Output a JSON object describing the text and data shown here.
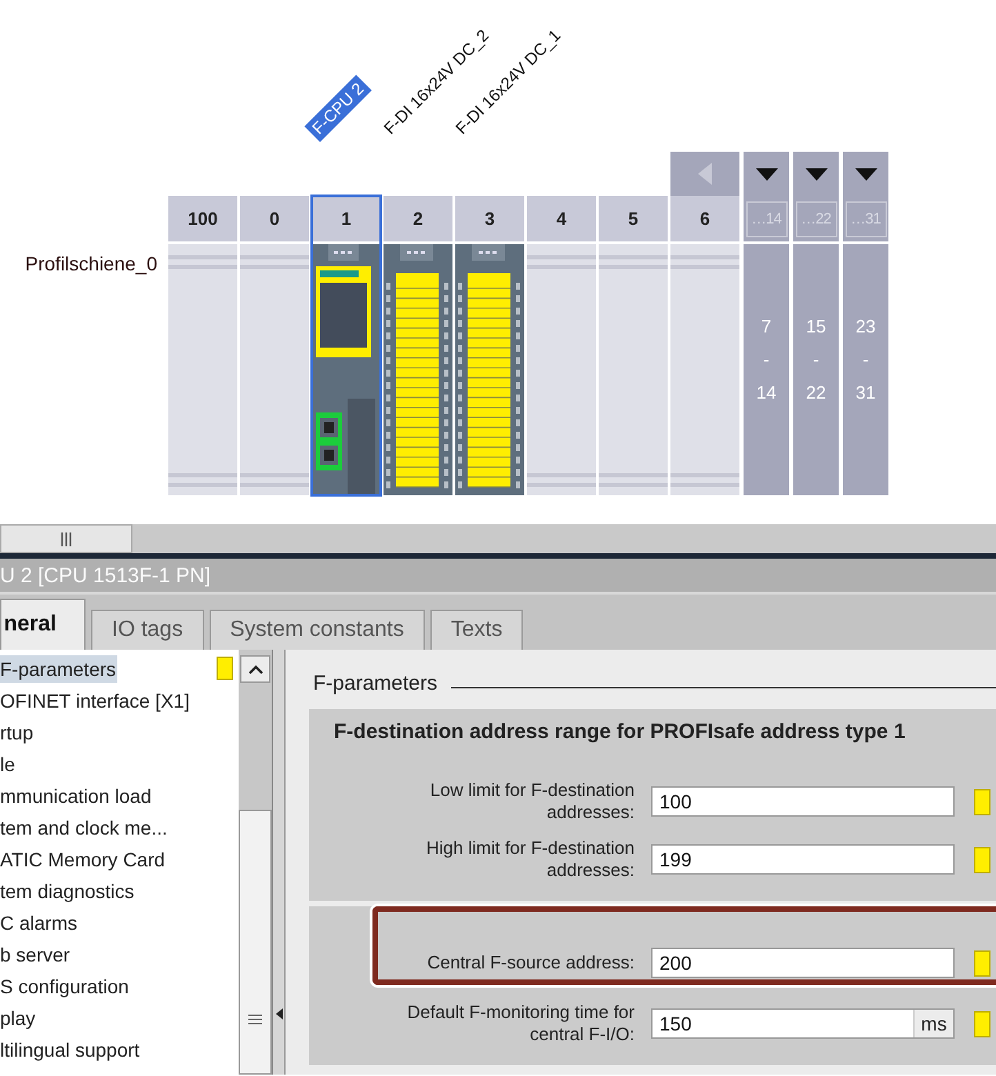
{
  "rack": {
    "rail_label": "Profilschiene_0",
    "slots": [
      {
        "number": "100",
        "kind": "empty",
        "selected": false
      },
      {
        "number": "0",
        "kind": "empty",
        "selected": false
      },
      {
        "number": "1",
        "kind": "cpu",
        "selected": true,
        "module_label": "F-CPU 2"
      },
      {
        "number": "2",
        "kind": "io",
        "selected": false,
        "module_label": "F-DI 16x24V DC_2"
      },
      {
        "number": "3",
        "kind": "io",
        "selected": false,
        "module_label": "F-DI 16x24V DC_1"
      },
      {
        "number": "4",
        "kind": "empty",
        "selected": false
      },
      {
        "number": "5",
        "kind": "empty",
        "selected": false
      },
      {
        "number": "6",
        "kind": "empty",
        "selected": false
      }
    ],
    "groups": [
      {
        "number": "…14",
        "range_start": "7",
        "range_sep": "-",
        "range_end": "14"
      },
      {
        "number": "…22",
        "range_start": "15",
        "range_sep": "-",
        "range_end": "22"
      },
      {
        "number": "…31",
        "range_start": "23",
        "range_sep": "-",
        "range_end": "31"
      }
    ]
  },
  "properties": {
    "title": "U 2 [CPU 1513F-1 PN]",
    "tabs": [
      {
        "label": "neral",
        "selected": true
      },
      {
        "label": "IO tags",
        "selected": false
      },
      {
        "label": "System constants",
        "selected": false
      },
      {
        "label": "Texts",
        "selected": false
      }
    ],
    "nav": [
      {
        "label": "F-parameters",
        "selected": true,
        "flagged": true
      },
      {
        "label": "OFINET interface [X1]",
        "selected": false,
        "flagged": false
      },
      {
        "label": "rtup",
        "selected": false,
        "flagged": false
      },
      {
        "label": "le",
        "selected": false,
        "flagged": false
      },
      {
        "label": "mmunication load",
        "selected": false,
        "flagged": false
      },
      {
        "label": "tem and clock me...",
        "selected": false,
        "flagged": false
      },
      {
        "label": "ATIC Memory Card",
        "selected": false,
        "flagged": false
      },
      {
        "label": "tem diagnostics",
        "selected": false,
        "flagged": false
      },
      {
        "label": "C alarms",
        "selected": false,
        "flagged": false
      },
      {
        "label": "b server",
        "selected": false,
        "flagged": false
      },
      {
        "label": "S configuration",
        "selected": false,
        "flagged": false
      },
      {
        "label": "play",
        "selected": false,
        "flagged": false
      },
      {
        "label": "ltilingual support",
        "selected": false,
        "flagged": false
      }
    ],
    "section": {
      "heading": "F-parameters",
      "groups": [
        {
          "heading": "F-destination address range for PROFIsafe address type 1",
          "fields": [
            {
              "label": "Low limit for F-destination addresses:",
              "value": "100",
              "highlighted": false
            },
            {
              "label": "High limit for F-destination addresses:",
              "value": "199",
              "highlighted": false
            }
          ]
        },
        {
          "fields": [
            {
              "label": "Central F-source address:",
              "value": "200",
              "highlighted": true
            },
            {
              "label": "Default F-monitoring time for central F-I/O:",
              "value": "150",
              "unit": "ms",
              "highlighted": false
            }
          ]
        }
      ]
    }
  }
}
